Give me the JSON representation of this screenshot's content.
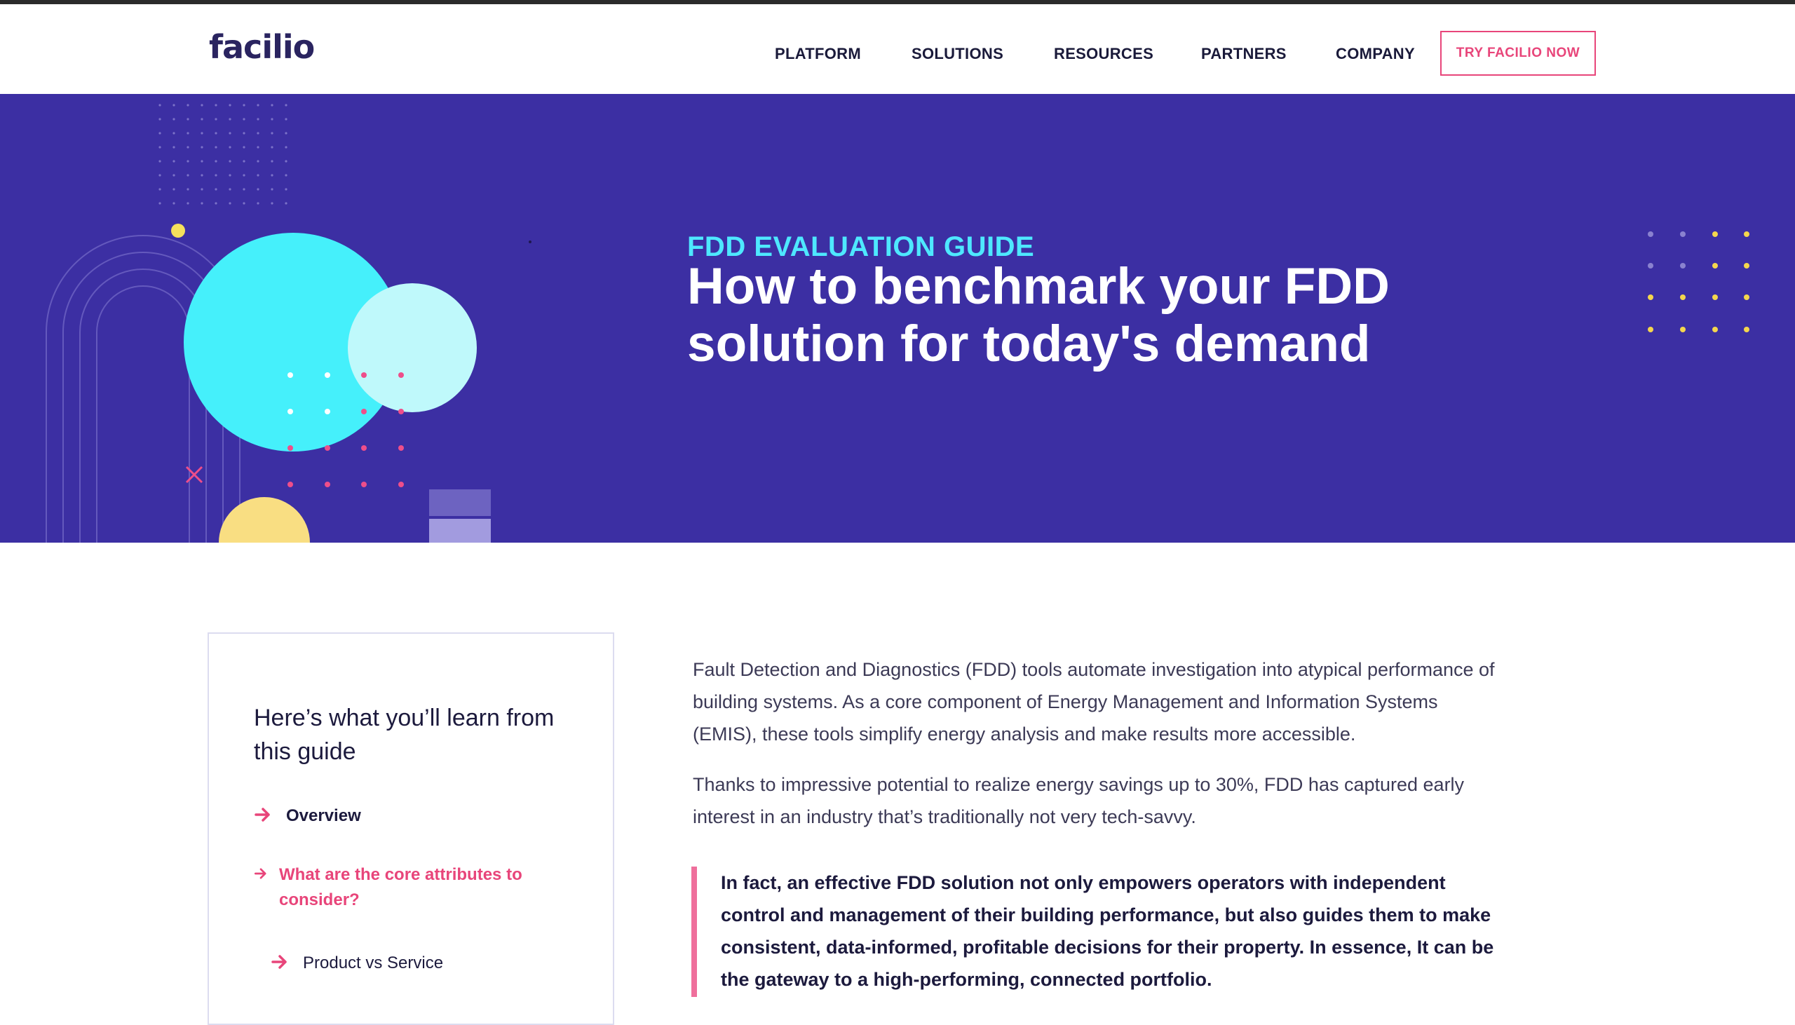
{
  "brand": {
    "logo_text": "facilio",
    "pink": "#e8457a",
    "purple": "#3c2fa3",
    "cyan": "#4ee8ff"
  },
  "nav": {
    "items": [
      "PLATFORM",
      "SOLUTIONS",
      "RESOURCES",
      "PARTNERS",
      "COMPANY"
    ],
    "cta": "TRY FACILIO NOW"
  },
  "hero": {
    "eyebrow": "FDD EVALUATION GUIDE",
    "title_line1": "How to benchmark your FDD",
    "title_line2": "solution for today's demand"
  },
  "toc": {
    "title": "Here’s what you’ll learn from this guide",
    "items": [
      {
        "label": "Overview",
        "icon": "arrow-right-icon"
      },
      {
        "label": "What are the core attributes to consider?",
        "icon": "arrow-right-icon"
      },
      {
        "label": "Product vs Service",
        "icon": "arrow-right-icon"
      }
    ]
  },
  "article": {
    "para1": "Fault Detection and Diagnostics (FDD) tools automate investigation into atypical performance of building systems. As a core component of Energy Management and Information Systems (EMIS), these tools simplify energy analysis and make results more accessible.",
    "para2": "Thanks to impressive potential to realize energy savings up to 30%, FDD has captured early interest in an industry that’s traditionally not very tech-savvy.",
    "quote": "In fact, an effective FDD solution not only empowers operators with independent control and management of their building performance, but also guides them to make consistent, data-informed, profitable decisions for their property. In essence, It can be the gateway to a high-performing, connected portfolio."
  }
}
